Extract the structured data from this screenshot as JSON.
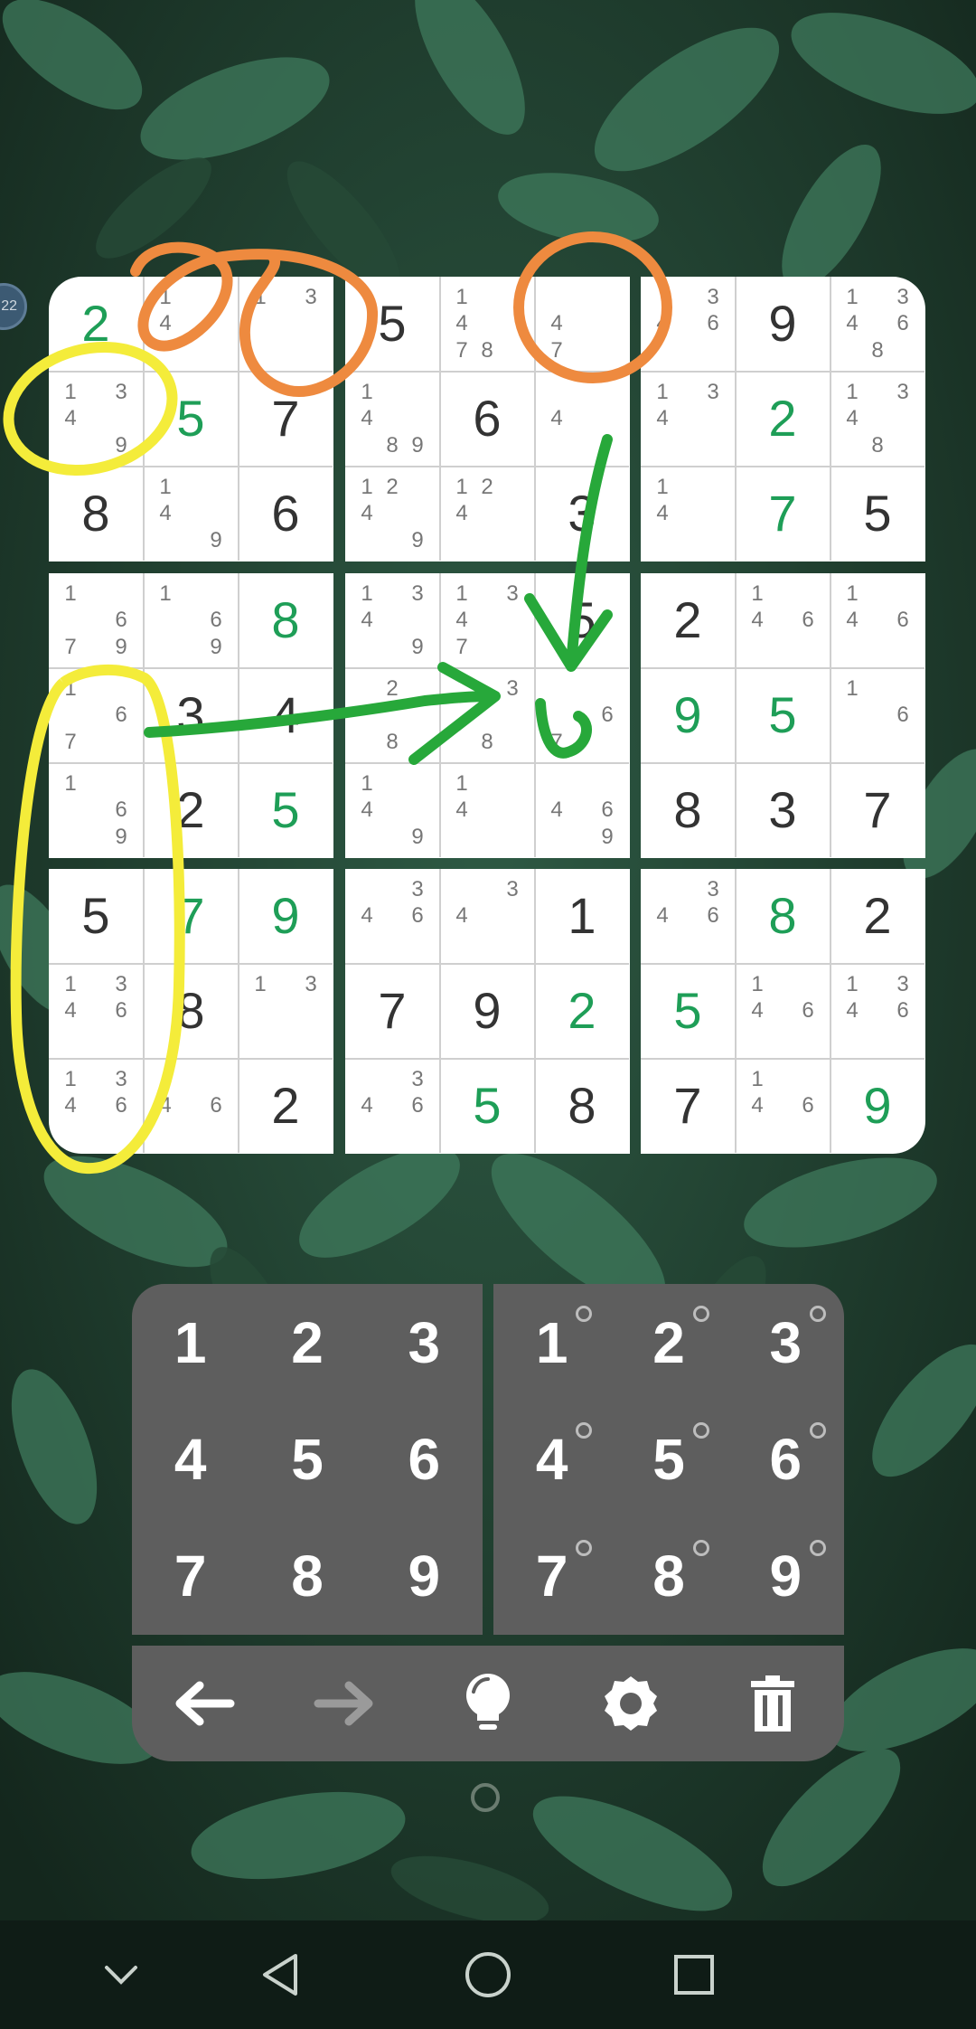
{
  "board": {
    "boxes": [
      {
        "cells": [
          {
            "v": "2",
            "t": "user"
          },
          {
            "n": [
              "1",
              "4"
            ]
          },
          {
            "n": [
              "1",
              "3"
            ]
          },
          {
            "n": [
              "1",
              "3",
              "4",
              "9"
            ]
          },
          {
            "v": "5",
            "t": "user"
          },
          {
            "v": "7",
            "t": "given"
          },
          {
            "v": "8",
            "t": "given"
          },
          {
            "n": [
              "1",
              "4",
              "9"
            ]
          },
          {
            "v": "6",
            "t": "given"
          }
        ]
      },
      {
        "cells": [
          {
            "v": "5",
            "t": "given"
          },
          {
            "n": [
              "1",
              "4",
              "7",
              "8"
            ]
          },
          {
            "n": [
              "4",
              "7"
            ]
          },
          {
            "n": [
              "1",
              "4",
              "8",
              "9"
            ]
          },
          {
            "v": "6",
            "t": "given"
          },
          {
            "n": [
              "4"
            ]
          },
          {
            "n": [
              "1",
              "2",
              "4",
              "9"
            ]
          },
          {
            "n": [
              "1",
              "2",
              "4"
            ]
          },
          {
            "v": "3",
            "t": "given"
          }
        ]
      },
      {
        "cells": [
          {
            "n": [
              "3",
              "4",
              "6"
            ]
          },
          {
            "v": "9",
            "t": "given"
          },
          {
            "n": [
              "1",
              "3",
              "4",
              "6",
              "8"
            ]
          },
          {
            "n": [
              "1",
              "3",
              "4"
            ]
          },
          {
            "v": "2",
            "t": "user"
          },
          {
            "n": [
              "1",
              "3",
              "4",
              "8"
            ]
          },
          {
            "n": [
              "1",
              "4"
            ]
          },
          {
            "v": "7",
            "t": "user"
          },
          {
            "v": "5",
            "t": "given"
          }
        ]
      },
      {
        "cells": [
          {
            "n": [
              "1",
              "6",
              "7",
              "9"
            ]
          },
          {
            "n": [
              "1",
              "6",
              "9"
            ]
          },
          {
            "v": "8",
            "t": "user"
          },
          {
            "n": [
              "1",
              "6",
              "7"
            ]
          },
          {
            "v": "3",
            "t": "given"
          },
          {
            "v": "4",
            "t": "given"
          },
          {
            "n": [
              "1",
              "6",
              "9"
            ]
          },
          {
            "v": "2",
            "t": "given"
          },
          {
            "v": "5",
            "t": "user"
          }
        ]
      },
      {
        "cells": [
          {
            "n": [
              "1",
              "3",
              "4",
              "9"
            ]
          },
          {
            "n": [
              "1",
              "3",
              "4",
              "7"
            ]
          },
          {
            "v": "5",
            "t": "given"
          },
          {
            "n": [
              "2",
              "8"
            ]
          },
          {
            "n": [
              "3",
              "8"
            ]
          },
          {
            "n": [
              "6",
              "7"
            ]
          },
          {
            "n": [
              "1",
              "4",
              "9"
            ]
          },
          {
            "n": [
              "1",
              "4"
            ]
          },
          {
            "n": [
              "4",
              "6",
              "9"
            ]
          }
        ]
      },
      {
        "cells": [
          {
            "v": "2",
            "t": "given"
          },
          {
            "n": [
              "1",
              "4",
              "6"
            ]
          },
          {
            "n": [
              "1",
              "4",
              "6"
            ]
          },
          {
            "v": "9",
            "t": "user"
          },
          {
            "v": "5",
            "t": "user"
          },
          {
            "n": [
              "1",
              "6"
            ]
          },
          {
            "v": "8",
            "t": "given"
          },
          {
            "v": "3",
            "t": "given"
          },
          {
            "v": "7",
            "t": "given"
          }
        ]
      },
      {
        "cells": [
          {
            "v": "5",
            "t": "given"
          },
          {
            "v": "7",
            "t": "user"
          },
          {
            "v": "9",
            "t": "user"
          },
          {
            "n": [
              "1",
              "3",
              "4",
              "6"
            ]
          },
          {
            "v": "8",
            "t": "given"
          },
          {
            "n": [
              "1",
              "3"
            ]
          },
          {
            "n": [
              "1",
              "3",
              "4",
              "6"
            ]
          },
          {
            "n": [
              "4",
              "6"
            ]
          },
          {
            "v": "2",
            "t": "given"
          }
        ]
      },
      {
        "cells": [
          {
            "n": [
              "3",
              "4",
              "6"
            ]
          },
          {
            "n": [
              "3",
              "4"
            ]
          },
          {
            "v": "1",
            "t": "given"
          },
          {
            "v": "7",
            "t": "given"
          },
          {
            "v": "9",
            "t": "given"
          },
          {
            "v": "2",
            "t": "user"
          },
          {
            "n": [
              "3",
              "4",
              "6"
            ]
          },
          {
            "v": "5",
            "t": "user"
          },
          {
            "v": "8",
            "t": "given"
          }
        ]
      },
      {
        "cells": [
          {
            "n": [
              "3",
              "4",
              "6"
            ]
          },
          {
            "v": "8",
            "t": "user"
          },
          {
            "v": "2",
            "t": "given"
          },
          {
            "v": "5",
            "t": "user"
          },
          {
            "n": [
              "1",
              "4",
              "6"
            ]
          },
          {
            "n": [
              "1",
              "3",
              "4",
              "6"
            ]
          },
          {
            "v": "7",
            "t": "given"
          },
          {
            "n": [
              "1",
              "4",
              "6"
            ]
          },
          {
            "v": "9",
            "t": "user"
          }
        ]
      }
    ]
  },
  "number_pad": {
    "keys": [
      "1",
      "2",
      "3",
      "4",
      "5",
      "6",
      "7",
      "8",
      "9"
    ]
  },
  "notes_pad": {
    "keys": [
      "1",
      "2",
      "3",
      "4",
      "5",
      "6",
      "7",
      "8",
      "9"
    ]
  },
  "toolbar": {
    "icons": [
      "undo-arrow-icon",
      "redo-arrow-icon",
      "hint-lightbulb-icon",
      "settings-gear-icon",
      "trash-icon"
    ]
  },
  "side_badge": {
    "text": "22"
  },
  "colors": {
    "user_digit": "#1e9e57",
    "given_digit": "#333333",
    "note_digit": "#777777",
    "pad_bg": "#5e5e5e",
    "annotation_orange": "#ee8a3f",
    "annotation_yellow": "#f4ec3a",
    "annotation_green": "#27a83a"
  },
  "navbar": {
    "icons": [
      "chevron-down-icon",
      "back-triangle-icon",
      "home-circle-icon",
      "recents-square-icon"
    ]
  }
}
